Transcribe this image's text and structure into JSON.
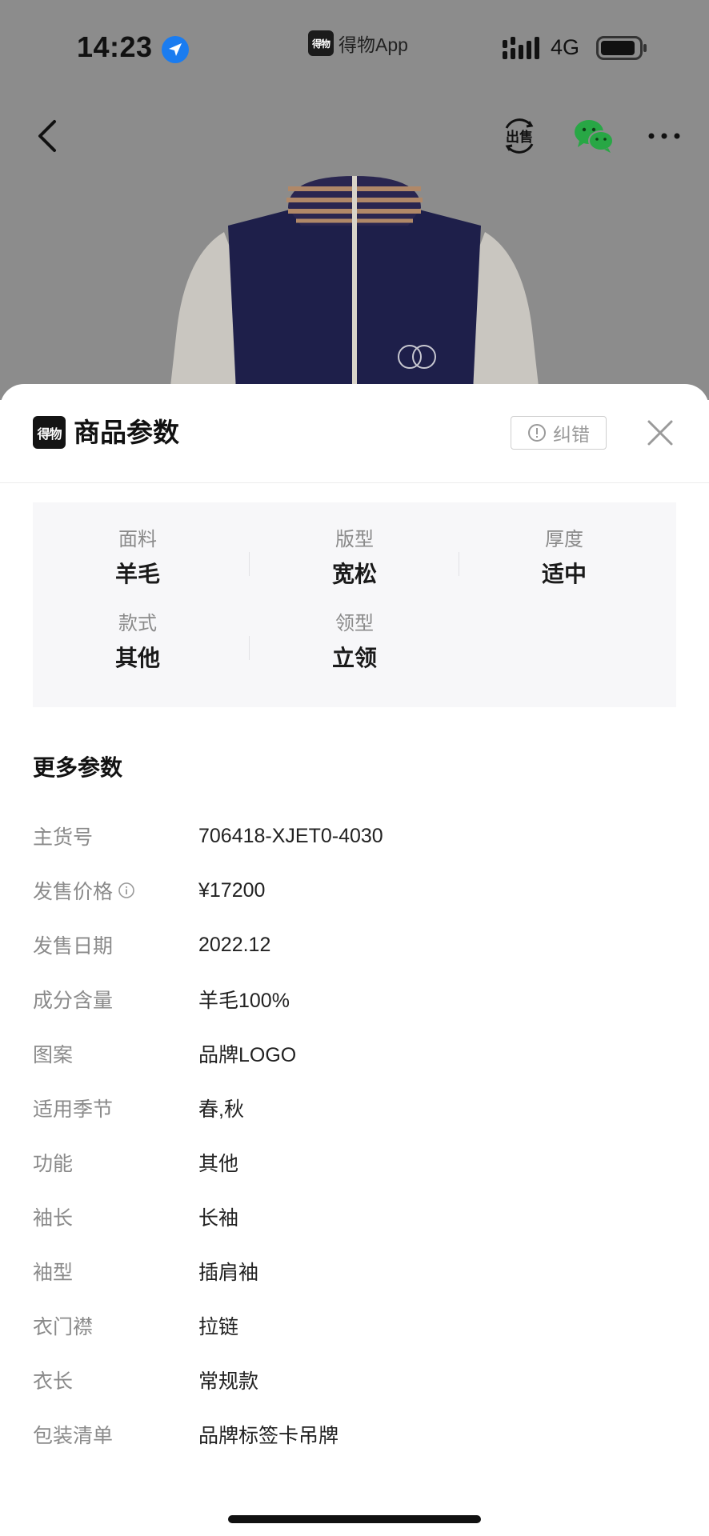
{
  "status_bar": {
    "time": "14:23",
    "app_name": "得物App",
    "app_logo_text": "得物",
    "network": "4G"
  },
  "sheet": {
    "logo_text": "得物",
    "title": "商品参数",
    "report_label": "纠错"
  },
  "key_params": [
    {
      "label": "面料",
      "value": "羊毛"
    },
    {
      "label": "版型",
      "value": "宽松"
    },
    {
      "label": "厚度",
      "value": "适中"
    },
    {
      "label": "款式",
      "value": "其他"
    },
    {
      "label": "领型",
      "value": "立领"
    }
  ],
  "more_params": {
    "title": "更多参数",
    "rows": [
      {
        "key": "主货号",
        "value": "706418-XJET0-4030"
      },
      {
        "key": "发售价格",
        "value": "¥17200",
        "has_info_icon": true
      },
      {
        "key": "发售日期",
        "value": "2022.12"
      },
      {
        "key": "成分含量",
        "value": "羊毛100%"
      },
      {
        "key": "图案",
        "value": "品牌LOGO"
      },
      {
        "key": "适用季节",
        "value": "春,秋"
      },
      {
        "key": "功能",
        "value": "其他"
      },
      {
        "key": "袖长",
        "value": "长袖"
      },
      {
        "key": "袖型",
        "value": "插肩袖"
      },
      {
        "key": "衣门襟",
        "value": "拉链"
      },
      {
        "key": "衣长",
        "value": "常规款"
      },
      {
        "key": "包装清单",
        "value": "品牌标签卡吊牌"
      }
    ]
  },
  "colors": {
    "overlay_bg": "#8c8c8c",
    "params_bg": "#f7f7f9",
    "label_gray": "#8a8a8a",
    "location_blue": "#1a7cf0",
    "wechat_green": "#28a745"
  }
}
